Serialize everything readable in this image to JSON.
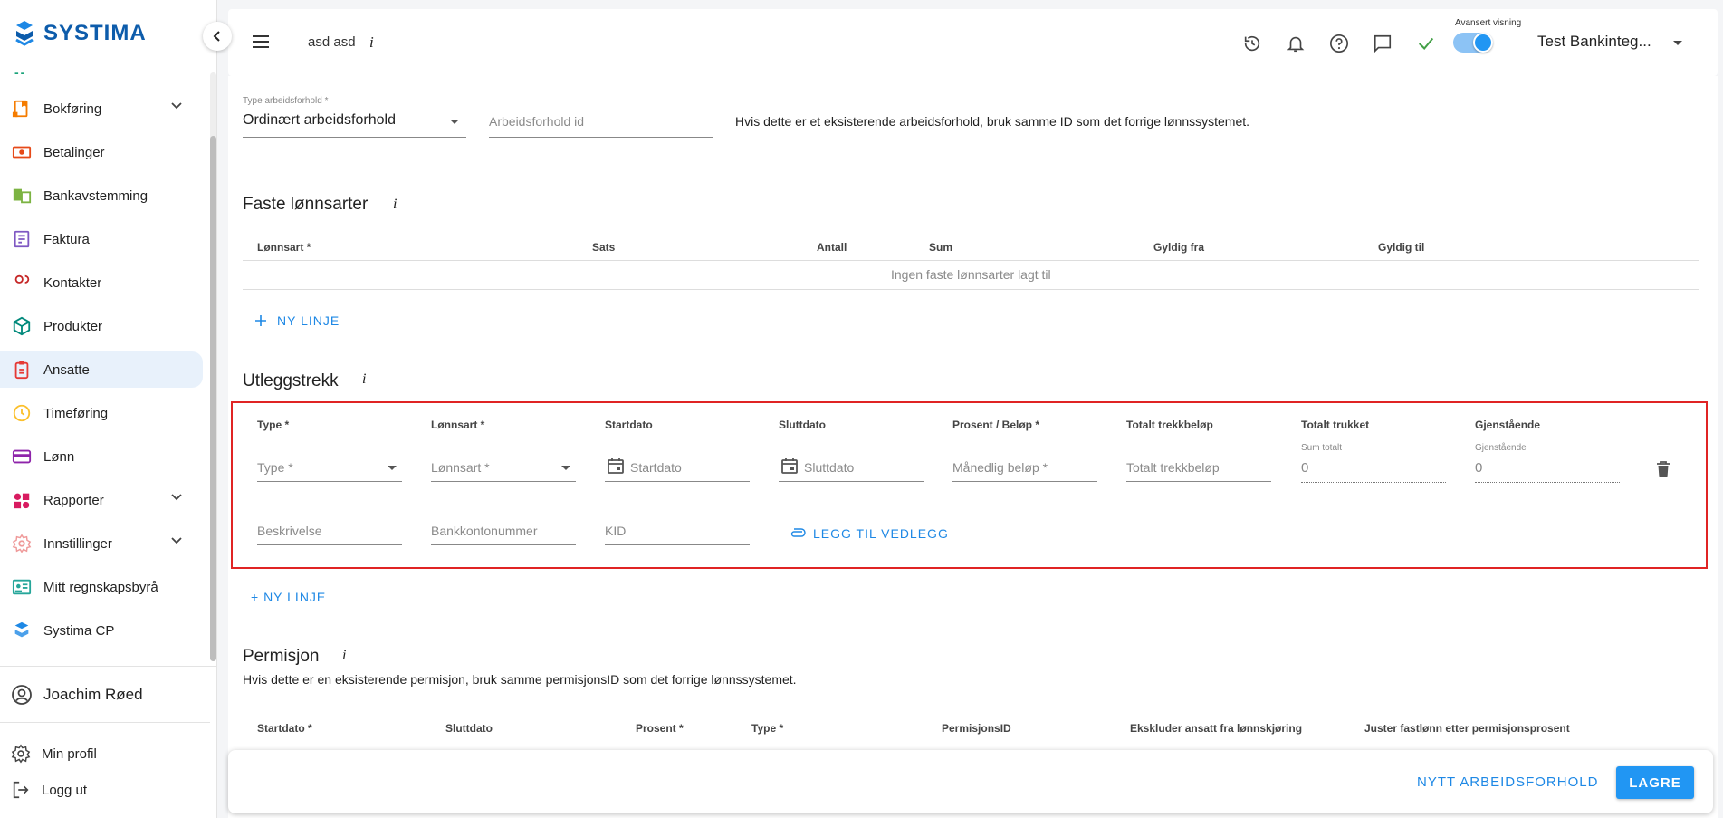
{
  "sidebar": {
    "logo_text": "SYSTIMA",
    "dash": "--",
    "items": [
      {
        "label": "Bokføring",
        "icon": "bookkeeping-icon",
        "color": "#f57c00",
        "expandable": true
      },
      {
        "label": "Betalinger",
        "icon": "payments-icon",
        "color": "#e64a19",
        "expandable": false
      },
      {
        "label": "Bankavstemming",
        "icon": "bank-reconciliation-icon",
        "color": "#7cb342",
        "expandable": false
      },
      {
        "label": "Faktura",
        "icon": "invoice-icon",
        "color": "#7e57c2",
        "expandable": false
      },
      {
        "label": "Kontakter",
        "icon": "contacts-icon",
        "color": "#c62828",
        "expandable": false
      },
      {
        "label": "Produkter",
        "icon": "products-icon",
        "color": "#00897b",
        "expandable": false
      },
      {
        "label": "Ansatte",
        "icon": "employees-icon",
        "color": "#e53935",
        "expandable": false,
        "active": true
      },
      {
        "label": "Timeføring",
        "icon": "time-tracking-icon",
        "color": "#fbc02d",
        "expandable": false
      },
      {
        "label": "Lønn",
        "icon": "payroll-icon",
        "color": "#8e24aa",
        "expandable": false
      },
      {
        "label": "Rapporter",
        "icon": "reports-icon",
        "color": "#d81b60",
        "expandable": true
      },
      {
        "label": "Innstillinger",
        "icon": "settings-icon",
        "color": "#ef9a9a",
        "expandable": true
      },
      {
        "label": "Mitt regnskapsbyrå",
        "icon": "accounting-agency-icon",
        "color": "#26a69a",
        "expandable": false
      },
      {
        "label": "Systima CP",
        "icon": "systima-cp-icon",
        "color": "#1e88e5",
        "expandable": false
      }
    ],
    "user_name": "Joachim Røed",
    "my_profile": "Min profil",
    "logout": "Logg ut"
  },
  "header": {
    "company": "asd asd",
    "info": "i",
    "toggle_label": "Avansert visning",
    "org_name": "Test Bankinteg...",
    "check_color": "#43a047"
  },
  "employment": {
    "type_label": "Type arbeidsforhold *",
    "type_value": "Ordinært arbeidsforhold",
    "id_placeholder": "Arbeidsforhold id",
    "note": "Hvis dette er et eksisterende arbeidsforhold, bruk samme ID som det forrige lønnssystemet."
  },
  "fixed_salary": {
    "title": "Faste lønnsarter",
    "info": "i",
    "columns": [
      "Lønnsart *",
      "Sats",
      "Antall",
      "Sum",
      "Gyldig fra",
      "Gyldig til"
    ],
    "empty_text": "Ingen faste lønnsarter lagt til",
    "new_line": "NY LINJE"
  },
  "deductions": {
    "title": "Utleggstrekk",
    "info": "i",
    "columns": [
      "Type *",
      "Lønnsart *",
      "Startdato",
      "Sluttdato",
      "Prosent / Beløp *",
      "Totalt trekkbeløp",
      "Totalt trukket",
      "Gjenstående"
    ],
    "row": {
      "type_ph": "Type *",
      "lonnsart_ph": "Lønnsart *",
      "start_ph": "Startdato",
      "end_ph": "Sluttdato",
      "monthly_ph": "Månedlig beløp *",
      "total_ph": "Totalt trekkbeløp",
      "sum_total_label": "Sum totalt",
      "sum_total_value": "0",
      "remaining_label": "Gjenstående",
      "remaining_value": "0",
      "description_ph": "Beskrivelse",
      "bank_ph": "Bankkontonummer",
      "kid_ph": "KID",
      "attach": "LEGG TIL VEDLEGG"
    },
    "new_line": "+ NY LINJE"
  },
  "leave": {
    "title": "Permisjon",
    "info": "i",
    "note": "Hvis dette er en eksisterende permisjon, bruk samme permisjonsID som det forrige lønnssystemet.",
    "columns": [
      "Startdato *",
      "Sluttdato",
      "Prosent *",
      "Type *",
      "PermisjonsID",
      "Ekskluder ansatt fra lønnskjøring",
      "Juster fastlønn etter permisjonsprosent"
    ]
  },
  "footer": {
    "new_employment": "NYTT ARBEIDSFORHOLD",
    "save": "LAGRE"
  }
}
